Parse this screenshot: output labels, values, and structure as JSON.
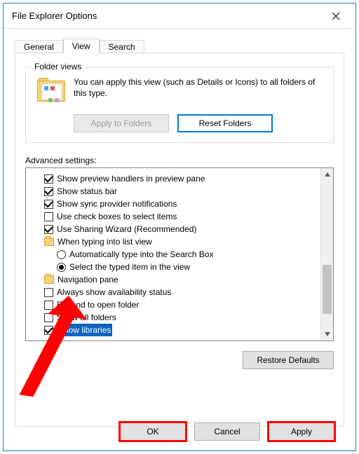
{
  "window": {
    "title": "File Explorer Options"
  },
  "tabs": {
    "general": "General",
    "view": "View",
    "search": "Search",
    "active": "view"
  },
  "folder_views": {
    "legend": "Folder views",
    "description": "You can apply this view (such as Details or Icons) to all folders of this type.",
    "apply_button": "Apply to Folders",
    "reset_button": "Reset Folders"
  },
  "advanced": {
    "label": "Advanced settings:",
    "items": [
      {
        "type": "check",
        "checked": true,
        "label": "Show preview handlers in preview pane"
      },
      {
        "type": "check",
        "checked": true,
        "label": "Show status bar"
      },
      {
        "type": "check",
        "checked": true,
        "label": "Show sync provider notifications"
      },
      {
        "type": "check",
        "checked": false,
        "label": "Use check boxes to select items"
      },
      {
        "type": "check",
        "checked": true,
        "label": "Use Sharing Wizard (Recommended)"
      },
      {
        "type": "group",
        "icon": "folder",
        "label": "When typing into list view"
      },
      {
        "type": "radio",
        "selected": false,
        "label": "Automatically type into the Search Box"
      },
      {
        "type": "radio",
        "selected": true,
        "label": "Select the typed item in the view"
      },
      {
        "type": "group",
        "icon": "folder-stack",
        "label": "Navigation pane"
      },
      {
        "type": "check",
        "checked": false,
        "label": "Always show availability status"
      },
      {
        "type": "check",
        "checked": false,
        "label": "Expand to open folder"
      },
      {
        "type": "check",
        "checked": false,
        "label": "Show all folders"
      },
      {
        "type": "check",
        "checked": true,
        "label": "Show libraries",
        "highlighted": true
      }
    ],
    "restore_button": "Restore Defaults"
  },
  "dialog_buttons": {
    "ok": "OK",
    "cancel": "Cancel",
    "apply": "Apply"
  }
}
